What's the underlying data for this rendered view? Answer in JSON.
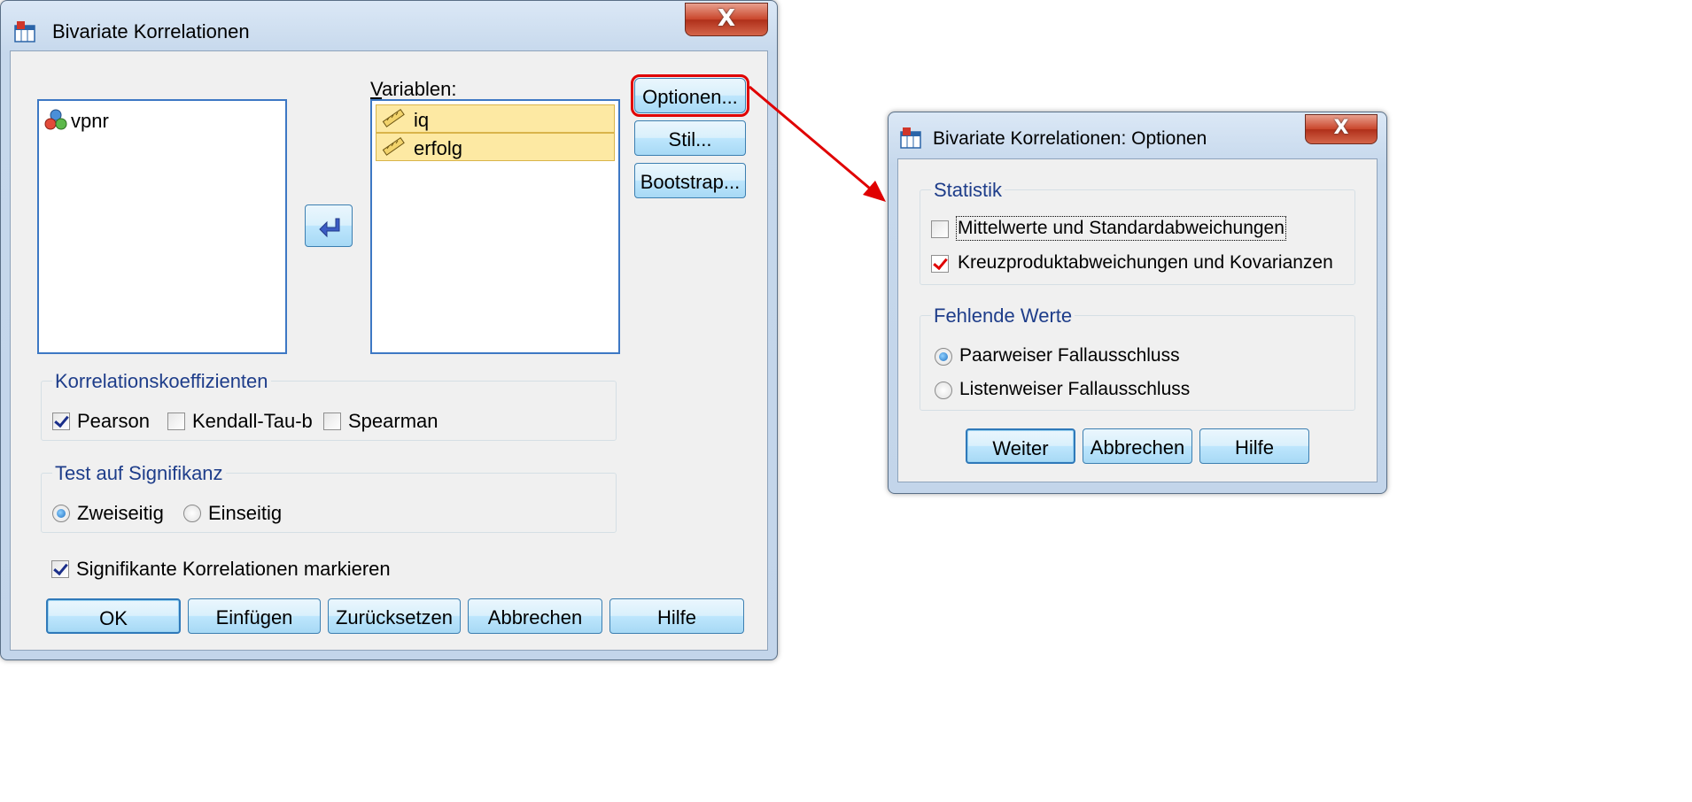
{
  "main_dialog": {
    "title": "Bivariate Korrelationen",
    "close_glyph": "X",
    "source_vars": [
      {
        "name": "vpnr",
        "icon": "nominal-variable-icon"
      }
    ],
    "target_label": "Variablen:",
    "target_vars": [
      {
        "name": "iq",
        "icon": "scale-ruler-icon"
      },
      {
        "name": "erfolg",
        "icon": "scale-ruler-icon"
      }
    ],
    "move_arrow_icon": "left-arrow-icon",
    "side_buttons": {
      "optionen": "Optionen...",
      "stil": "Stil...",
      "bootstrap": "Bootstrap..."
    },
    "coeff_group": {
      "title": "Korrelationskoeffizienten",
      "pearson": {
        "label": "Pearson",
        "checked": true
      },
      "kendall": {
        "label": "Kendall-Tau-b",
        "checked": false
      },
      "spearman": {
        "label": "Spearman",
        "checked": false
      }
    },
    "sig_group": {
      "title": "Test auf Signifikanz",
      "zweiseitig": {
        "label": "Zweiseitig",
        "selected": true
      },
      "einseitig": {
        "label": "Einseitig",
        "selected": false
      }
    },
    "flag": {
      "label": "Signifikante Korrelationen markieren",
      "checked": true
    },
    "footer_buttons": {
      "ok": "OK",
      "einfuegen": "Einfügen",
      "zuruecksetzen": "Zurücksetzen",
      "abbrechen": "Abbrechen",
      "hilfe": "Hilfe"
    }
  },
  "options_dialog": {
    "title": "Bivariate Korrelationen: Optionen",
    "close_glyph": "X",
    "stat_group": {
      "title": "Statistik",
      "means": {
        "label": "Mittelwerte und Standardabweichungen",
        "checked": false
      },
      "crossprod": {
        "label": "Kreuzproduktabweichungen und Kovarianzen",
        "checked": true
      }
    },
    "missing_group": {
      "title": "Fehlende Werte",
      "pairwise": {
        "label": "Paarweiser Fallausschluss",
        "selected": true
      },
      "listwise": {
        "label": "Listenweiser Fallausschluss",
        "selected": false
      }
    },
    "buttons": {
      "weiter": "Weiter",
      "abbrechen": "Abbrechen",
      "hilfe": "Hilfe"
    }
  },
  "annotation": {
    "highlight_color": "#e00000",
    "arrow_color": "#e00000"
  }
}
